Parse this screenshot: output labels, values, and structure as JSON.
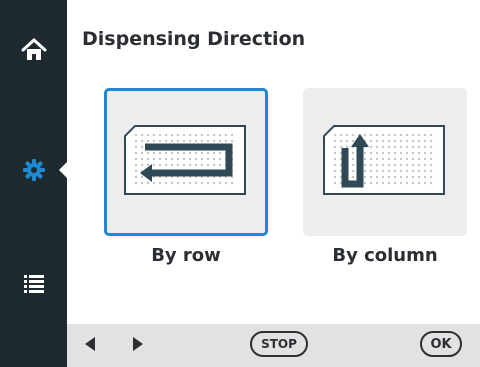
{
  "page": {
    "title": "Dispensing Direction"
  },
  "sidebar": {
    "items": [
      {
        "icon": "home-icon",
        "active": false
      },
      {
        "icon": "gear-icon",
        "active": true
      },
      {
        "icon": "list-icon",
        "active": false
      }
    ]
  },
  "options": [
    {
      "label": "By row",
      "icon": "row-direction-icon",
      "selected": true
    },
    {
      "label": "By column",
      "icon": "column-direction-icon",
      "selected": false
    }
  ],
  "footer": {
    "back_icon": "arrow-left-icon",
    "forward_icon": "arrow-right-icon",
    "stop_label": "STOP",
    "ok_label": "OK"
  },
  "colors": {
    "sidebar": "#1f2a30",
    "accent": "#1e88d0",
    "icon_fill": "#2f4a56",
    "footer": "#e2e2e2"
  }
}
